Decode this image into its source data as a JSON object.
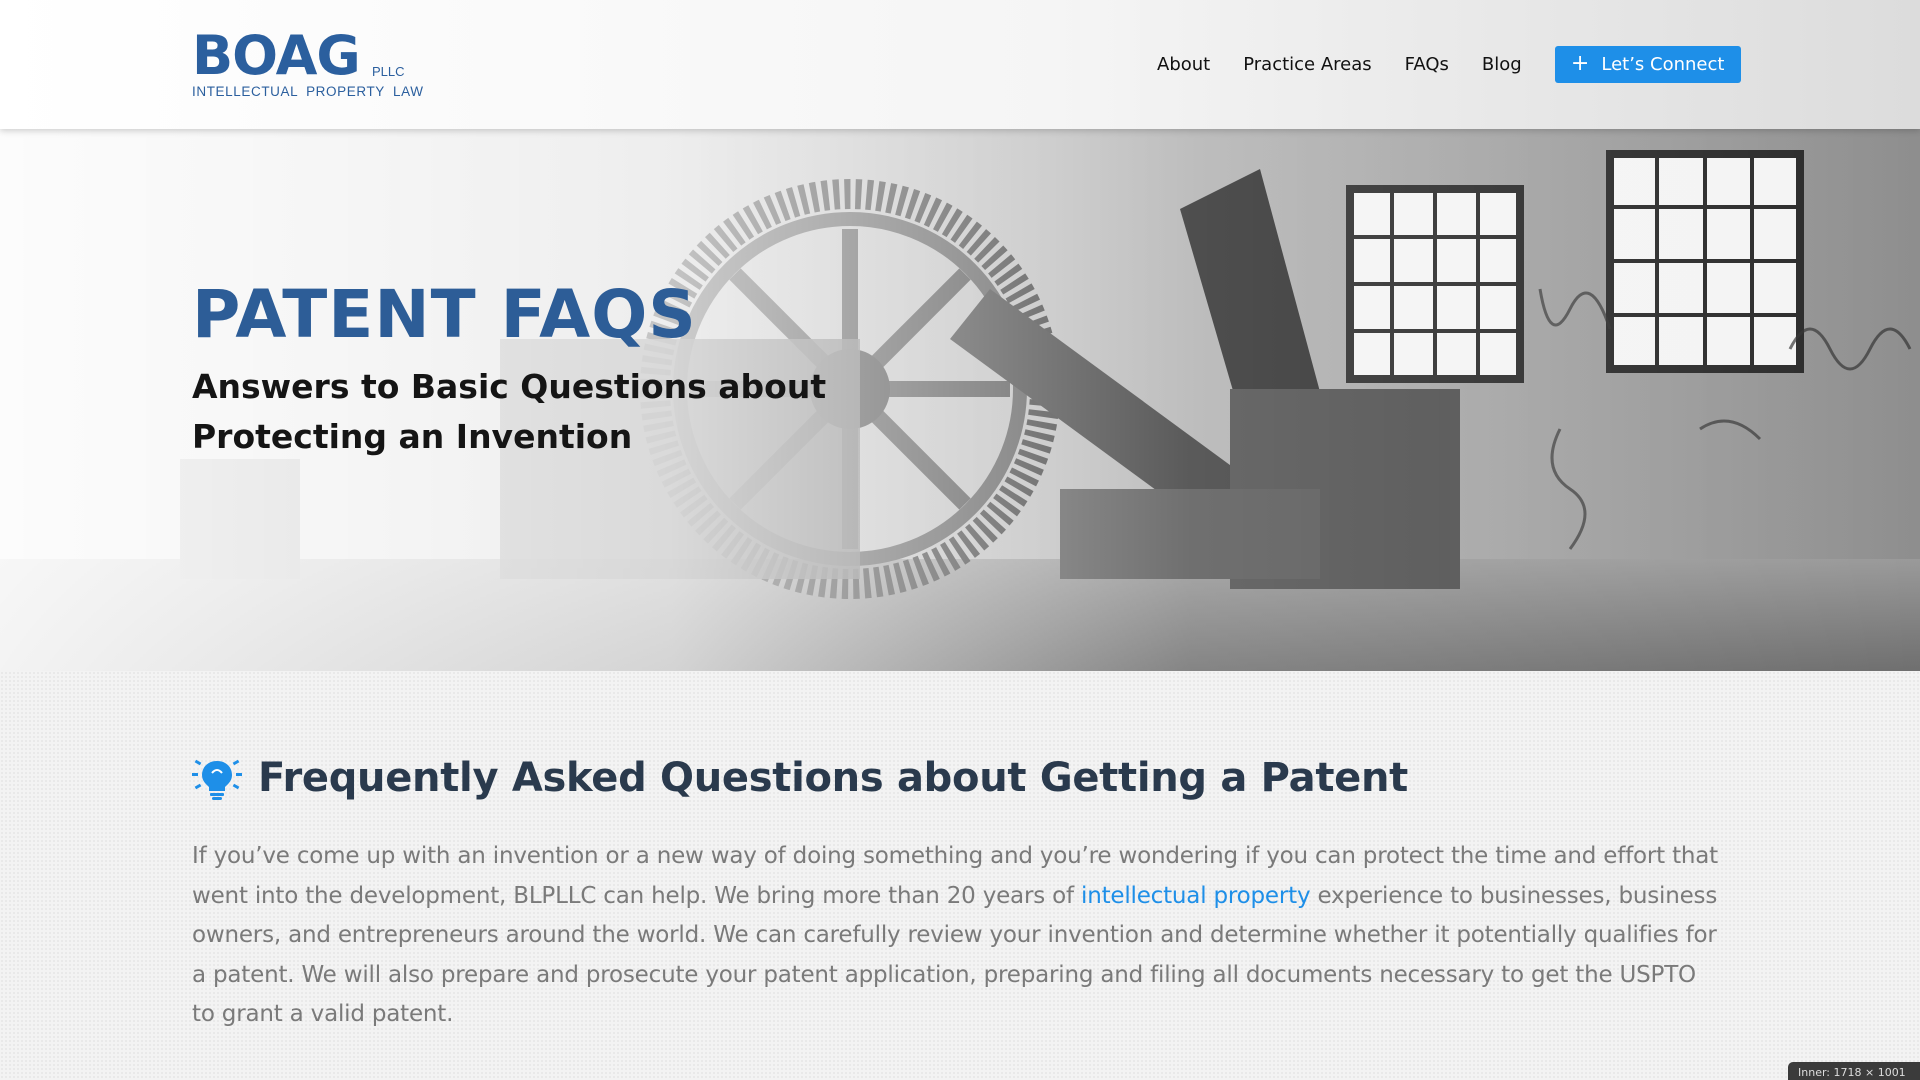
{
  "header": {
    "logo_main": "BOAG",
    "logo_suffix": "PLLC",
    "logo_tagline": "INTELLECTUAL PROPERTY LAW",
    "nav": {
      "about": "About",
      "practice_areas": "Practice Areas",
      "faqs": "FAQs",
      "blog": "Blog",
      "connect": "Let’s Connect",
      "connect_icon": "plus-icon"
    }
  },
  "hero": {
    "title": "PATENT FAQS",
    "subtitle": "Answers to Basic Questions about Protecting an Invention"
  },
  "section": {
    "icon": "lightbulb-icon",
    "heading": "Frequently Asked Questions about Getting a Patent",
    "para_part1": "If you’ve come up with an invention or a new way of doing something and you’re wondering if you can protect the time and effort that went into the development, BLPLLC can help. We bring more than 20 years of ",
    "para_link": "intellectual property",
    "para_part2": " experience to businesses, business owners, and entrepreneurs  around the world. We can carefully review your invention and determine whether it potentially qualifies for a patent. We will also prepare and prosecute your patent application, preparing and filing all documents necessary to get the USPTO to grant a valid patent."
  },
  "overlay_badge": "Inner: 1718 × 1001",
  "colors": {
    "brand_blue": "#2b5f9e",
    "accent_blue": "#1e8fe8",
    "heading_dark": "#2a3a4d",
    "body_gray": "#7a7a7a"
  }
}
